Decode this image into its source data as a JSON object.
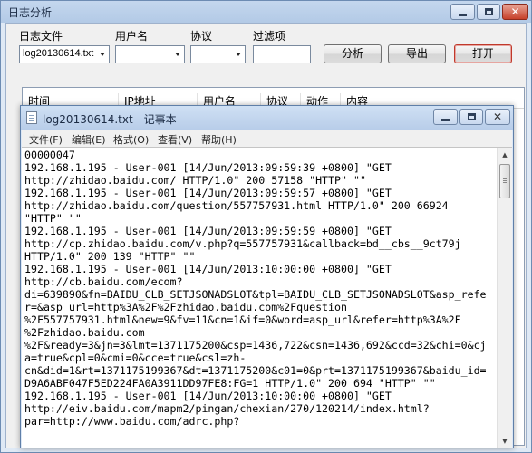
{
  "main_window": {
    "title": "日志分析",
    "controls": {
      "minimize": "minimize-icon",
      "maximize": "maximize-icon",
      "close": "close-icon"
    }
  },
  "filters": {
    "file_label": "日志文件",
    "file_value": "log20130614.txt",
    "user_label": "用户名",
    "user_value": "",
    "protocol_label": "协议",
    "protocol_value": "",
    "filter_label": "过滤项",
    "filter_value": ""
  },
  "buttons": {
    "analyze": "分析",
    "export": "导出",
    "open": "打开"
  },
  "list": {
    "columns": [
      "时间",
      "IP地址",
      "用户名",
      "协议",
      "动作",
      "内容"
    ]
  },
  "notepad": {
    "title": "log20130614.txt - 记事本",
    "menu": [
      "文件(F)",
      "编辑(E)",
      "格式(O)",
      "查看(V)",
      "帮助(H)"
    ],
    "lines": [
      "00000047",
      "192.168.1.195 - User-001 [14/Jun/2013:09:59:39 +0800] \"GET",
      "http://zhidao.baidu.com/ HTTP/1.0\" 200 57158 \"HTTP\" \"\"",
      "192.168.1.195 - User-001 [14/Jun/2013:09:59:57 +0800] \"GET",
      "http://zhidao.baidu.com/question/557757931.html HTTP/1.0\" 200 66924",
      "\"HTTP\" \"\"",
      "192.168.1.195 - User-001 [14/Jun/2013:09:59:59 +0800] \"GET",
      "http://cp.zhidao.baidu.com/v.php?q=557757931&callback=bd__cbs__9ct79j",
      "HTTP/1.0\" 200 139 \"HTTP\" \"\"",
      "192.168.1.195 - User-001 [14/Jun/2013:10:00:00 +0800] \"GET",
      "http://cb.baidu.com/ecom?",
      "di=639890&fn=BAIDU_CLB_SETJSONADSLOT&tpl=BAIDU_CLB_SETJSONADSLOT&asp_refe",
      "r=&asp_url=http%3A%2F%2Fzhidao.baidu.com%2Fquestion",
      "%2F557757931.html&new=9&fv=11&cn=1&if=0&word=asp_url&refer=http%3A%2F",
      "%2Fzhidao.baidu.com",
      "%2F&ready=3&jn=3&lmt=1371175200&csp=1436,722&csn=1436,692&ccd=32&chi=0&cj",
      "a=true&cpl=0&cmi=0&cce=true&csl=zh-",
      "cn&did=1&rt=1371175199367&dt=1371175200&c01=0&prt=1371175199367&baidu_id=",
      "D9A6ABF047F5ED224FA0A3911DD97FE8:FG=1 HTTP/1.0\" 200 694 \"HTTP\" \"\"",
      "192.168.1.195 - User-001 [14/Jun/2013:10:00:00 +0800] \"GET",
      "http://eiv.baidu.com/mapm2/pingan/chexian/270/120214/index.html?",
      "par=http://www.baidu.com/adrc.php?"
    ]
  }
}
